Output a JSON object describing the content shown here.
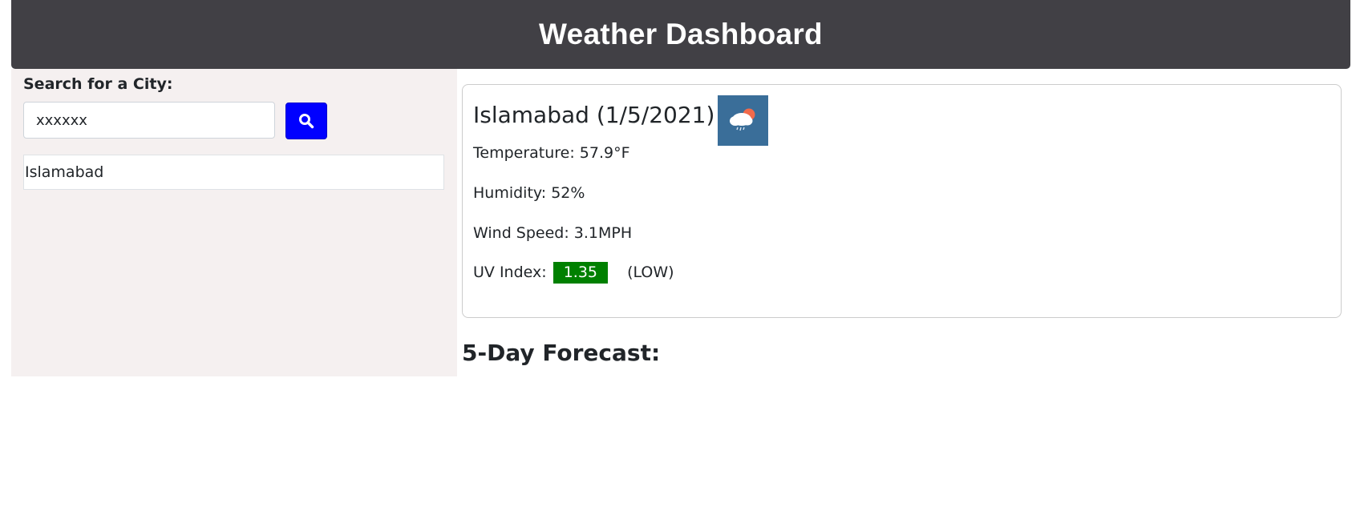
{
  "header": {
    "title": "Weather Dashboard"
  },
  "sidebar": {
    "search_label": "Search for a City:",
    "search_value": "xxxxxx",
    "search_button_icon": "search-icon",
    "history": [
      {
        "city": "Islamabad"
      }
    ]
  },
  "current": {
    "title": "Islamabad (1/5/2021)",
    "icon": "cloud-rain-sun-icon",
    "temperature_label": "Temperature: 57.9°F",
    "humidity_label": "Humidity: 52%",
    "wind_label": "Wind Speed: 3.1MPH",
    "uv_label": "UV Index:",
    "uv_value": "1.35",
    "uv_rating": "(LOW)"
  },
  "forecast": {
    "title": "5-Day Forecast:"
  },
  "colors": {
    "header_bg": "#414045",
    "sidebar_bg": "#f5f0f0",
    "search_button_bg": "#0000ff",
    "uv_low": "#008000",
    "icon_bg": "#3a6e99"
  }
}
